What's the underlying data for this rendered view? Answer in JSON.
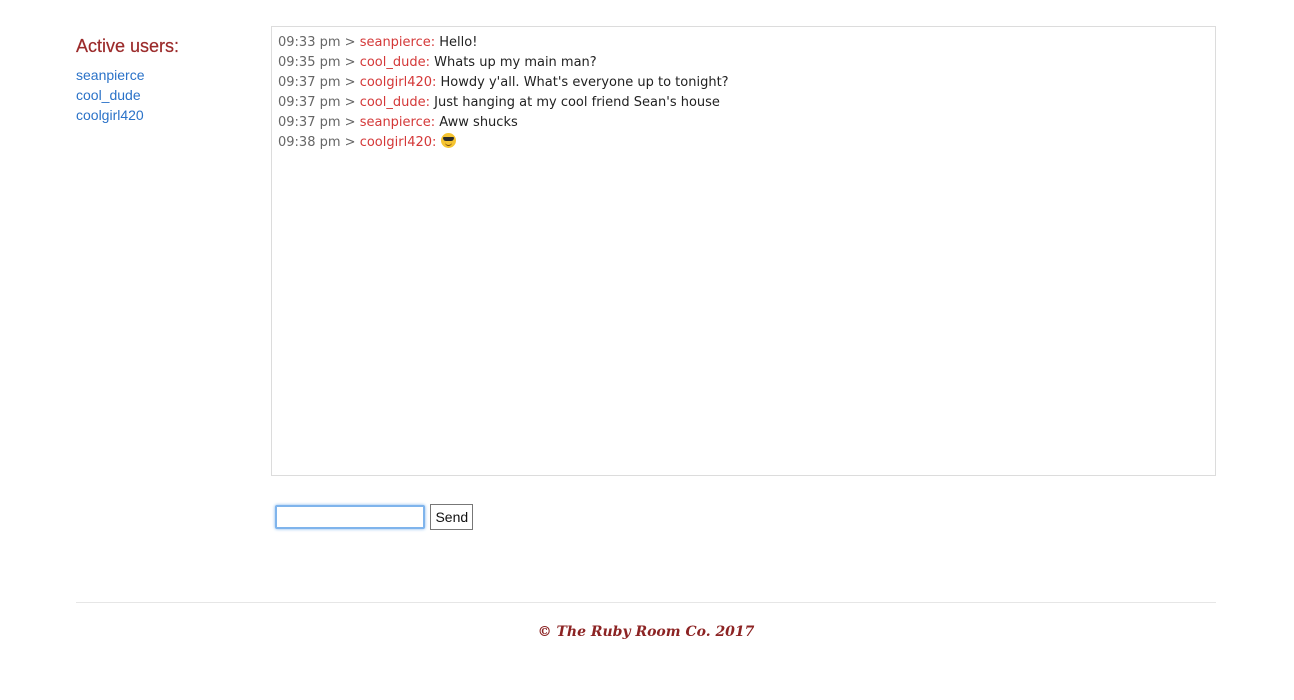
{
  "sidebar": {
    "title": "Active users:",
    "users": [
      "seanpierce",
      "cool_dude",
      "coolgirl420"
    ]
  },
  "messages": [
    {
      "time": "09:33 pm",
      "sep": ">",
      "user": "seanpierce:",
      "text": "Hello!"
    },
    {
      "time": "09:35 pm",
      "sep": ">",
      "user": "cool_dude:",
      "text": "Whats up my main man?"
    },
    {
      "time": "09:37 pm",
      "sep": ">",
      "user": "coolgirl420:",
      "text": "Howdy y'all. What's everyone up to tonight?"
    },
    {
      "time": "09:37 pm",
      "sep": ">",
      "user": "cool_dude:",
      "text": "Just hanging at my cool friend Sean's house"
    },
    {
      "time": "09:37 pm",
      "sep": ">",
      "user": "seanpierce:",
      "text": "Aww shucks"
    },
    {
      "time": "09:38 pm",
      "sep": ">",
      "user": "coolgirl420:",
      "text": "",
      "emoji": "sunglasses-emoji"
    }
  ],
  "composer": {
    "input_value": "",
    "send_label": "Send"
  },
  "footer": {
    "text": "© The Ruby Room Co. 2017"
  },
  "colors": {
    "heading": "#9b2a2a",
    "user_link": "#2a72c8",
    "message_user": "#d43838",
    "footer": "#8c2323",
    "input_focus": "#7fb4ec"
  }
}
